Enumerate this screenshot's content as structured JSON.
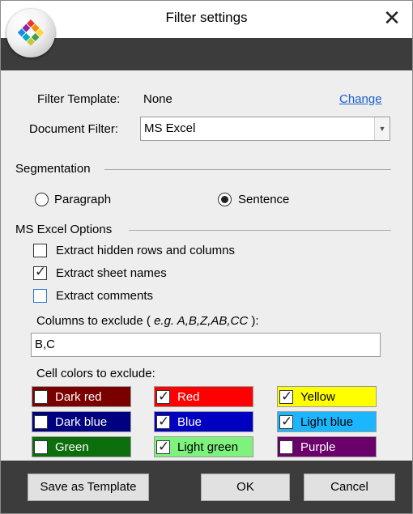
{
  "window": {
    "title": "Filter settings",
    "close_glyph": "✕"
  },
  "filter_template": {
    "label": "Filter Template:",
    "value": "None",
    "change_link": "Change"
  },
  "document_filter": {
    "label": "Document Filter:",
    "selected": "MS Excel"
  },
  "segmentation": {
    "label": "Segmentation",
    "options": [
      {
        "label": "Paragraph",
        "checked": false
      },
      {
        "label": "Sentence",
        "checked": true
      }
    ]
  },
  "excel_options": {
    "label": "MS Excel Options",
    "checkboxes": [
      {
        "label": "Extract hidden rows and columns",
        "checked": false
      },
      {
        "label": "Extract sheet names",
        "checked": true
      },
      {
        "label": "Extract comments",
        "checked": false
      }
    ],
    "columns_label_prefix": "Columns to exclude ( ",
    "columns_label_example": "e.g. A,B,Z,AB,CC",
    "columns_label_suffix": " ):",
    "columns_value": "B,C",
    "cell_colors_label": "Cell colors to exclude:",
    "cell_colors": [
      {
        "label": "Dark red",
        "color": "#7a0000",
        "text_color": "#ffffff",
        "checked": false
      },
      {
        "label": "Red",
        "color": "#ff0000",
        "text_color": "#ffffff",
        "checked": true
      },
      {
        "label": "Yellow",
        "color": "#ffff00",
        "text_color": "#000000",
        "checked": true
      },
      {
        "label": "Dark blue",
        "color": "#000080",
        "text_color": "#ffffff",
        "checked": false
      },
      {
        "label": "Blue",
        "color": "#0000c0",
        "text_color": "#ffffff",
        "checked": true
      },
      {
        "label": "Light blue",
        "color": "#1cb6ff",
        "text_color": "#000000",
        "checked": true
      },
      {
        "label": "Green",
        "color": "#0d6e0d",
        "text_color": "#ffffff",
        "checked": false
      },
      {
        "label": "Light green",
        "color": "#7df27d",
        "text_color": "#000000",
        "checked": true
      },
      {
        "label": "Purple",
        "color": "#6a006a",
        "text_color": "#ffffff",
        "checked": false
      }
    ]
  },
  "buttons": {
    "save_template": "Save as Template",
    "ok": "OK",
    "cancel": "Cancel"
  },
  "icons": {
    "check": "✓",
    "dropdown_arrow": "▼"
  }
}
